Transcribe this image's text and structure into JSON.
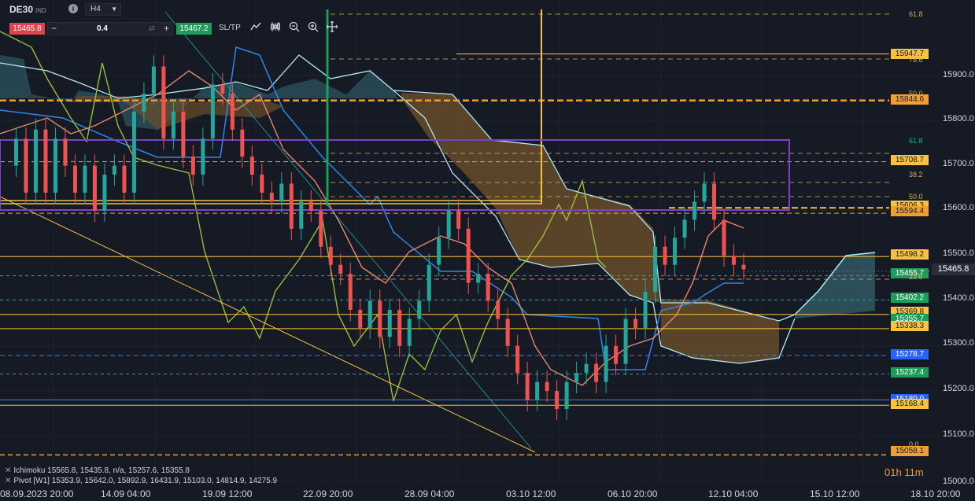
{
  "header": {
    "symbol": "DE30",
    "symbol_suffix": "IND",
    "info_icon": "i",
    "timeframe": "H4",
    "sell_price": "15465.8",
    "quantity": "0.4",
    "buy_price": "15467.2",
    "sltp_label": "SL/TP"
  },
  "icons": [
    "info-icon",
    "chevron-down-icon",
    "minus-icon",
    "swap-icon",
    "plus-icon",
    "line-chart-icon",
    "candles-icon",
    "zoom-out-icon",
    "zoom-in-icon",
    "crosshair-icon"
  ],
  "y_axis": {
    "labels": [
      "15900.0",
      "15800.0",
      "15700.0",
      "15600.0",
      "15500.0",
      "15400.0",
      "15300.0",
      "15200.0",
      "15100.0",
      "15000.0"
    ]
  },
  "x_axis": {
    "labels": [
      "08.09.2023 20:00",
      "14.09 04:00",
      "19.09 12:00",
      "22.09 20:00",
      "28.09 04:00",
      "03.10 12:00",
      "06.10 20:00",
      "12.10 04:00",
      "15.10 12:00",
      "18.10 20:00"
    ]
  },
  "current_price": "15465.8",
  "price_labels": [
    {
      "text": "15947.7",
      "color": "#f5c242"
    },
    {
      "text": "15844.6",
      "color": "#f0a030"
    },
    {
      "text": "15708.7",
      "color": "#f5c242"
    },
    {
      "text": "15606.3",
      "color": "#f5c242"
    },
    {
      "text": "15594.4",
      "color": "#f0a030"
    },
    {
      "text": "15498.2",
      "color": "#f5c242"
    },
    {
      "text": "15455.7",
      "color": "#1f9b5c"
    },
    {
      "text": "15402.2",
      "color": "#1f9b5c"
    },
    {
      "text": "15369.8",
      "color": "#f5c242"
    },
    {
      "text": "15355.7",
      "color": "#1f9b5c"
    },
    {
      "text": "15338.3",
      "color": "#f5c242"
    },
    {
      "text": "15278.7",
      "color": "#2962ff"
    },
    {
      "text": "15237.4",
      "color": "#1f9b5c"
    },
    {
      "text": "15180.0",
      "color": "#2962ff"
    },
    {
      "text": "15168.4",
      "color": "#f5c242"
    },
    {
      "text": "15058.1",
      "color": "#f0a030"
    }
  ],
  "fib_labels": [
    "61.8",
    "78.6",
    "50.0",
    "61.8",
    "38.2",
    "50.0",
    "23.6",
    "0.0"
  ],
  "legend": {
    "ichimoku": "Ichimoku 15565.8, 15435.8, n/a, 15257.6, 15355.8",
    "pivot": "Pivot [W1] 15353.9, 15642.0, 15892.9, 16431.9, 15103.0, 14814.9, 14275.9"
  },
  "timer": "01h 11m",
  "chart_data": {
    "type": "candlestick",
    "timeframe": "H4",
    "ylim": [
      15000,
      15950
    ],
    "x_ticks": [
      "08.09.2023 20:00",
      "14.09 04:00",
      "19.09 12:00",
      "22.09 20:00",
      "28.09 04:00",
      "03.10 12:00",
      "06.10 20:00",
      "12.10 04:00",
      "15.10 12:00",
      "18.10 20:00"
    ],
    "y_ticks": [
      15000,
      15100,
      15200,
      15300,
      15400,
      15500,
      15600,
      15700,
      15800,
      15900
    ],
    "close_path": [
      15700,
      15760,
      15640,
      15780,
      15640,
      15760,
      15700,
      15640,
      15700,
      15600,
      15680,
      15700,
      15640,
      15820,
      15860,
      15920,
      15760,
      15820,
      15720,
      15680,
      15760,
      15880,
      15860,
      15780,
      15720,
      15680,
      15640,
      15620,
      15660,
      15560,
      15620,
      15600,
      15520,
      15480,
      15460,
      15380,
      15340,
      15400,
      15320,
      15380,
      15300,
      15360,
      15400,
      15480,
      15540,
      15600,
      15560,
      15440,
      15460,
      15400,
      15360,
      15300,
      15240,
      15180,
      15220,
      15200,
      15160,
      15220,
      15240,
      15260,
      15220,
      15300,
      15260,
      15360,
      15340,
      15420,
      15520,
      15480,
      15540,
      15580,
      15620,
      15660,
      15580,
      15500,
      15480,
      15470
    ],
    "horizontal_levels": [
      15947.7,
      15844.6,
      15708.7,
      15606.3,
      15594.4,
      15498.2,
      15455.7,
      15402.2,
      15369.8,
      15355.7,
      15338.3,
      15278.7,
      15237.4,
      15180.0,
      15168.4,
      15058.1
    ]
  }
}
